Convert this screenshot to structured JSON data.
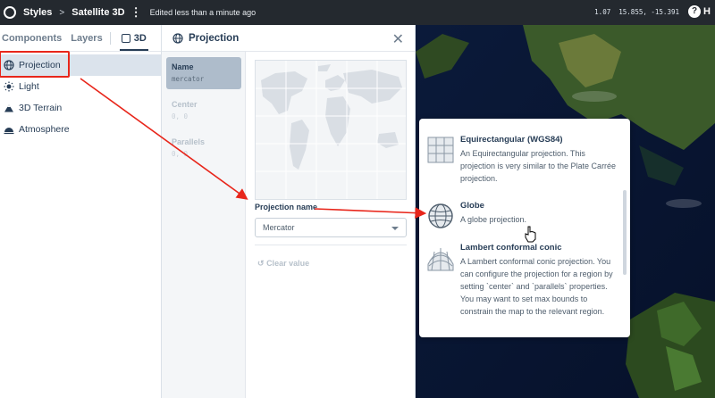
{
  "topbar": {
    "breadcrumb_root": "Styles",
    "breadcrumb_sep": ">",
    "breadcrumb_style": "Satellite 3D",
    "edited": "Edited less than a minute ago",
    "coords": "1.07  15.855, -15.391",
    "help_label": "H"
  },
  "sidebar": {
    "tabs": [
      "Components",
      "Layers",
      "3D"
    ],
    "active_tab": "3D",
    "items": [
      {
        "label": "Projection",
        "icon": "globe-icon"
      },
      {
        "label": "Light",
        "icon": "light-icon"
      },
      {
        "label": "3D Terrain",
        "icon": "mountain-icon"
      },
      {
        "label": "Atmosphere",
        "icon": "atmosphere-icon"
      }
    ]
  },
  "panel": {
    "title": "Projection",
    "subnav": [
      {
        "label": "Name",
        "value": "mercator"
      },
      {
        "label": "Center",
        "value": "0, 0"
      },
      {
        "label": "Parallels",
        "value": "0, 0"
      }
    ],
    "field_label": "Projection name",
    "select_value": "Mercator",
    "clear_label": "Clear value"
  },
  "dropdown": {
    "options": [
      {
        "title": "Equirectangular (WGS84)",
        "desc": "An Equirectangular projection. This projection is very similar to the Plate Carrée projection."
      },
      {
        "title": "Globe",
        "desc": "A globe projection."
      },
      {
        "title": "Lambert conformal conic",
        "desc": "A Lambert conformal conic projection. You can configure the projection for a region by setting `center` and `parallels` properties. You may want to set max bounds to constrain the map to the relevant region."
      }
    ]
  },
  "colors": {
    "annotation": "#e8261b",
    "topbar": "#24292f",
    "text": "#273d56"
  }
}
